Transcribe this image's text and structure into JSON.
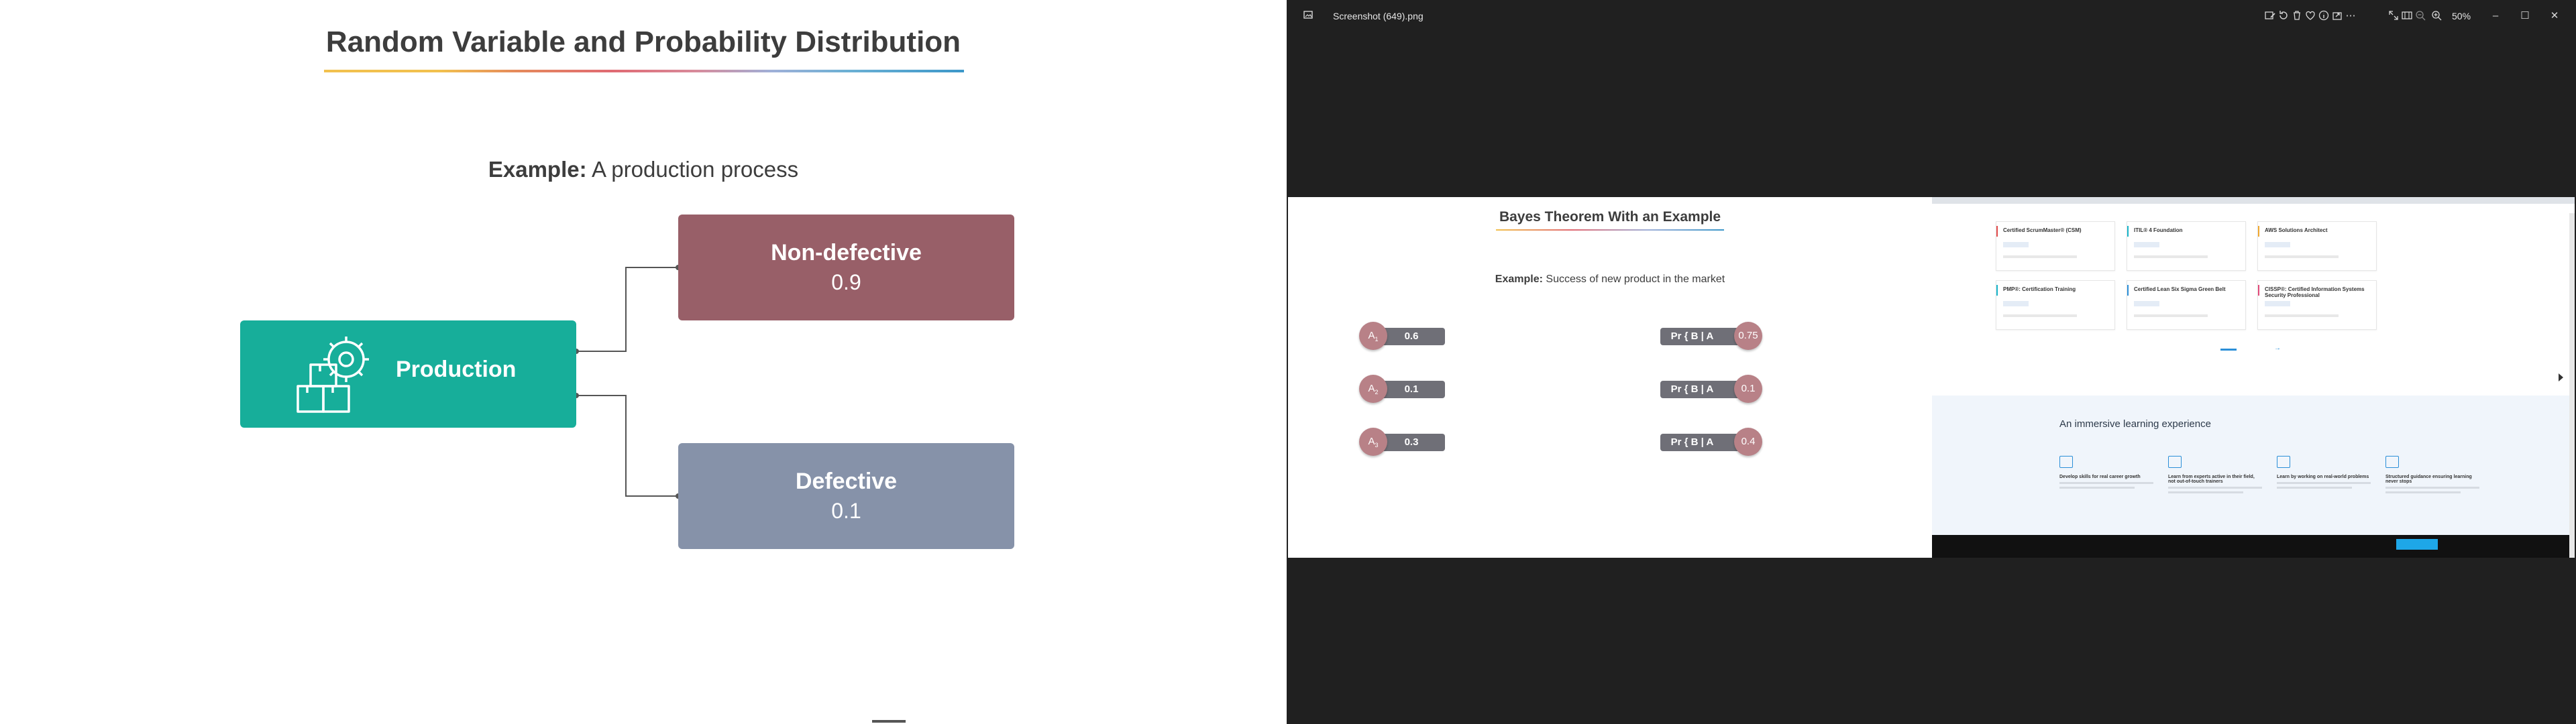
{
  "left_slide": {
    "title": "Random Variable and Probability Distribution",
    "example_label": "Example:",
    "example_text": "A production process",
    "production_label": "Production",
    "nondefective_label": "Non-defective",
    "nondefective_value": "0.9",
    "defective_label": "Defective",
    "defective_value": "0.1",
    "colors": {
      "production": "#17ae9a",
      "nondefective": "#985f68",
      "defective": "#8692a9"
    }
  },
  "viewer": {
    "file_title": "Screenshot (649).png",
    "zoom": "50%",
    "toolbar_icons": [
      "edit-image-icon",
      "rotate-icon",
      "delete-icon",
      "favorite-icon",
      "info-icon",
      "share-icon",
      "more-icon"
    ],
    "right_icons": [
      "fullscreen-icon",
      "filmstrip-icon",
      "zoom-out-icon",
      "zoom-in-icon"
    ],
    "window_controls": [
      "minimize-icon",
      "maximize-icon",
      "close-icon"
    ]
  },
  "inner_slide": {
    "title": "Bayes Theorem With an Example",
    "example_label": "Example:",
    "example_text": "Success of new product in the market",
    "priors": [
      {
        "label": "A",
        "sub": "1",
        "value": "0.6"
      },
      {
        "label": "A",
        "sub": "2",
        "value": "0.1"
      },
      {
        "label": "A",
        "sub": "3",
        "value": "0.3"
      }
    ],
    "likelihoods": [
      {
        "prefix": "Pr { B | A",
        "sub": "1",
        "suffix": " }",
        "value": "0.75"
      },
      {
        "prefix": "Pr { B | A",
        "sub": "2",
        "suffix": " }",
        "value": "0.1"
      },
      {
        "prefix": "Pr { B | A",
        "sub": "3",
        "suffix": " }",
        "value": "0.4"
      }
    ]
  },
  "browser": {
    "cards": [
      {
        "title": "Certified ScrumMaster® (CSM)",
        "accent": "#e24a4a"
      },
      {
        "title": "ITIL® 4 Foundation",
        "accent": "#17b4c9"
      },
      {
        "title": "AWS Solutions Architect",
        "accent": "#f0a830"
      },
      {
        "title": "PMP®: Certification Training",
        "accent": "#17b4c9"
      },
      {
        "title": "Certified Lean Six Sigma Green Belt",
        "accent": "#2b8fd8"
      },
      {
        "title": "CISSP®: Certified Information Systems Security Professional",
        "accent": "#e24a7a"
      }
    ],
    "learning_heading": "An immersive learning experience",
    "features": [
      {
        "title": "Develop skills for real career growth"
      },
      {
        "title": "Learn from experts active in their field, not out-of-touch trainers"
      },
      {
        "title": "Learn by working on real-world problems"
      },
      {
        "title": "Structured guidance ensuring learning never stops"
      }
    ]
  }
}
